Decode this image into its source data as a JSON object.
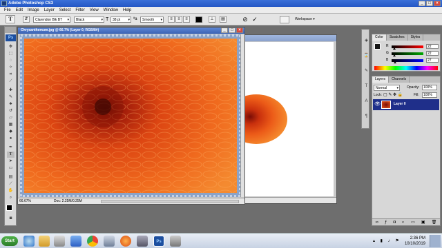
{
  "app": {
    "title": "Adobe Photoshop CS3"
  },
  "menu": [
    "File",
    "Edit",
    "Image",
    "Layer",
    "Select",
    "Filter",
    "View",
    "Window",
    "Help"
  ],
  "options": {
    "font_family": "Clarendon Blk BT",
    "font_style": "Black",
    "font_size": "38 pt",
    "antialias": "Smooth",
    "workspace_label": "Workspace ▾"
  },
  "doc_front": {
    "title": "Chrysanthemum.jpg @ 66.7% (Layer 0, RGB/8#)",
    "zoom": "66.67%",
    "doc_info": "Doc: 2.25M/0.25M"
  },
  "color_panel": {
    "tabs": [
      "Color",
      "Swatches",
      "Styles"
    ],
    "rows": [
      {
        "label": "R",
        "value": "22",
        "level": 0.086
      },
      {
        "label": "G",
        "value": "22",
        "level": 0.086
      },
      {
        "label": "B",
        "value": "27",
        "level": 0.106
      }
    ]
  },
  "layers_panel": {
    "tabs": [
      "Layers",
      "Channels"
    ],
    "blend_mode": "Normal",
    "opacity_label": "Opacity:",
    "opacity": "100%",
    "lock_label": "Lock:",
    "fill_label": "Fill:",
    "fill": "100%",
    "layers": [
      {
        "name": "Layer 0"
      }
    ]
  },
  "taskbar": {
    "start_label": "Start",
    "time": "2:36 PM",
    "date": "10/10/2019"
  },
  "colors": {
    "accent": "#1f2f8a",
    "flower": "#e8561a"
  }
}
